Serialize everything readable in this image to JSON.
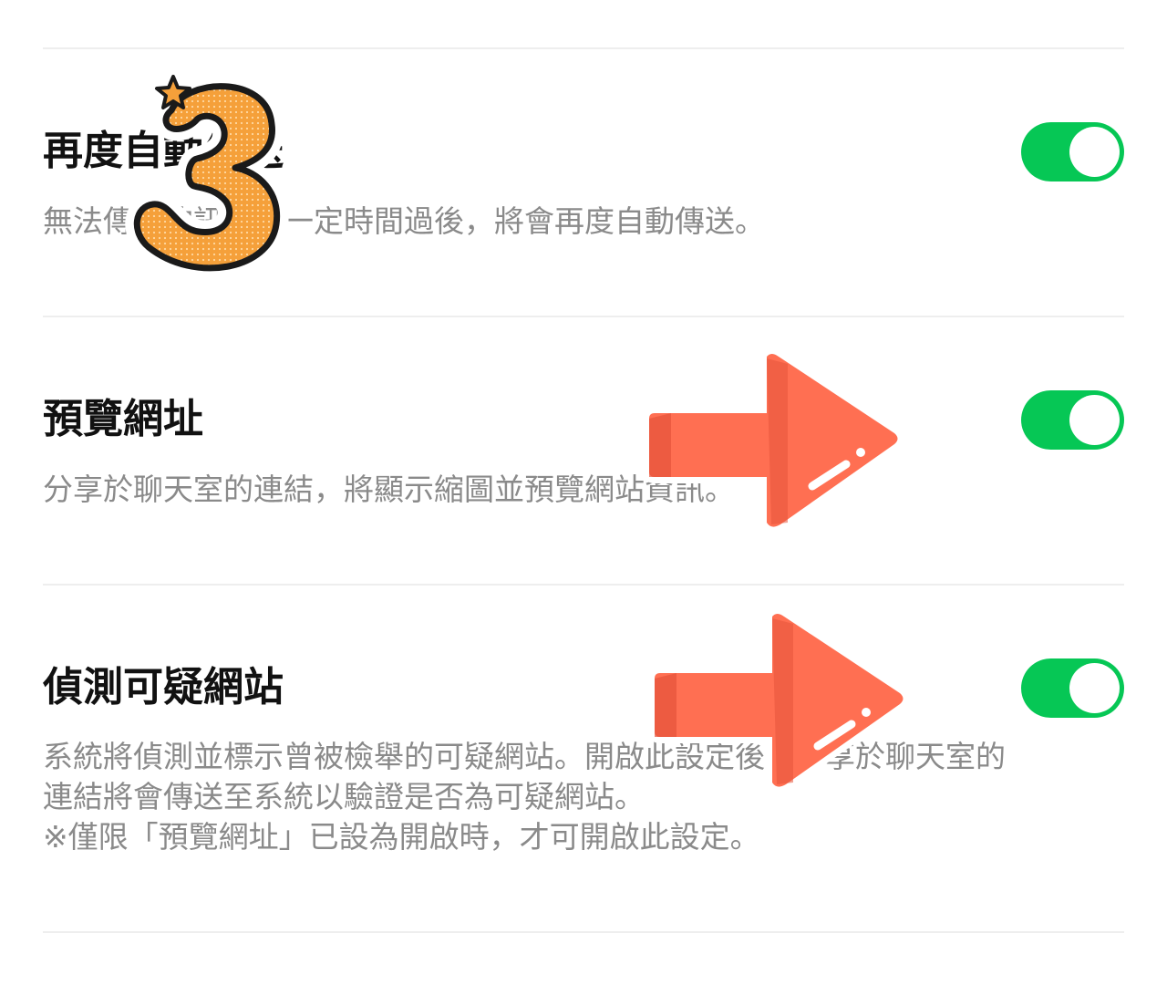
{
  "settings": [
    {
      "title": "再度自動傳送",
      "description": "無法傳送的訊息於一定時間過後，將會再度自動傳送。",
      "toggle_state": "on"
    },
    {
      "title": "預覽網址",
      "description": "分享於聊天室的連結，將顯示縮圖並預覽網站資訊。",
      "toggle_state": "on"
    },
    {
      "title": "偵測可疑網站",
      "description_lines": [
        "系統將偵測並標示曾被檢舉的可疑網站。開啟此設定後，分享於聊天室的",
        "連結將會傳送至系統以驗證是否為可疑網站。",
        "※僅限「預覽網址」已設為開啟時，才可開啟此設定。"
      ],
      "toggle_state": "on"
    }
  ],
  "colors": {
    "toggle_on": "#06c755",
    "arrow": "#ff6f52",
    "badge_orange": "#f5a03a"
  },
  "overlays": {
    "step_badge_number": "3",
    "arrow_icon": "right-arrow-icon"
  }
}
